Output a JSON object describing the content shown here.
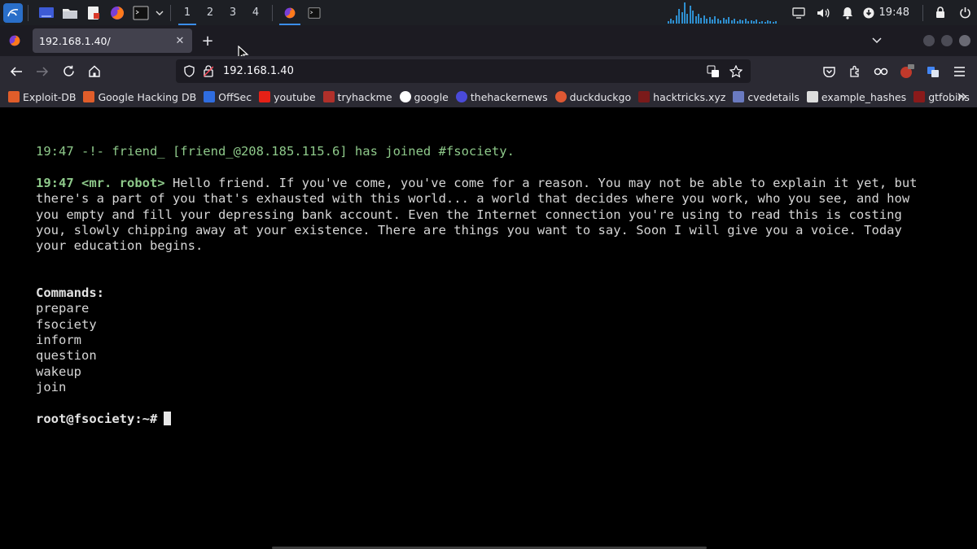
{
  "system_panel": {
    "workspaces": [
      "1",
      "2",
      "3",
      "4"
    ],
    "active_workspace": "1",
    "clock": "19:48",
    "icons": [
      "kali-menu-icon",
      "desktop-icon",
      "file-manager-icon",
      "text-editor-icon",
      "firefox-icon",
      "terminal-icon",
      "dropdown-icon",
      "firefox-task-icon",
      "terminal-task-icon",
      "network-graph",
      "display-icon",
      "volume-icon",
      "notification-icon",
      "update-icon",
      "lock-icon",
      "power-icon"
    ],
    "accent_color": "#3b8eea"
  },
  "browser": {
    "tab": {
      "title": "192.168.1.40/",
      "close": "✕"
    },
    "new_tab": "+",
    "url": "192.168.1.40",
    "bookmarks": [
      {
        "label": "Exploit-DB",
        "icon": "exploit-db-icon",
        "color": "#e05d2a"
      },
      {
        "label": "Google Hacking DB",
        "icon": "ghdb-icon",
        "color": "#e05d2a"
      },
      {
        "label": "OffSec",
        "icon": "offsec-icon",
        "color": "#2f6de0"
      },
      {
        "label": "youtube",
        "icon": "youtube-icon",
        "color": "#e62117"
      },
      {
        "label": "tryhackme",
        "icon": "tryhackme-icon",
        "color": "#b0302a"
      },
      {
        "label": "google",
        "icon": "google-icon",
        "color": "#ffffff"
      },
      {
        "label": "thehackernews",
        "icon": "thehackernews-icon",
        "color": "#4a4ad9"
      },
      {
        "label": "duckduckgo",
        "icon": "duckduckgo-icon",
        "color": "#de5833"
      },
      {
        "label": "hacktricks.xyz",
        "icon": "hacktricks-icon",
        "color": "#7a1a1a"
      },
      {
        "label": "cvedetails",
        "icon": "cvedetails-icon",
        "color": "#6a7ac0"
      },
      {
        "label": "example_hashes",
        "icon": "hashcat-icon",
        "color": "#dddddd"
      },
      {
        "label": "gtfobins",
        "icon": "gtfobins-icon",
        "color": "#8a1a1a"
      }
    ]
  },
  "terminal": {
    "join_line": "19:47 -!- friend_ [friend_@208.185.115.6] has joined #fsociety.",
    "msg_prefix": "19:47 <mr. robot>",
    "msg_line1": " Hello friend. If you've come, you've come for a reason. You may not be able to explain it yet, but",
    "msg_line2": "there's a part of you that's exhausted with this world... a world that decides where you work, who you see, and how",
    "msg_line3": "you empty and fill your depressing bank account. Even the Internet connection you're using to read this is costing",
    "msg_line4": "you, slowly chipping away at your existence. There are things you want to say. Soon I will give you a voice. Today",
    "msg_line5": "your education begins.",
    "commands_heading": "Commands:",
    "commands": [
      "prepare",
      "fsociety",
      "inform",
      "question",
      "wakeup",
      "join"
    ],
    "prompt": "root@fsociety:~#",
    "green": "#8ec98a",
    "text": "#d6d6d6"
  }
}
